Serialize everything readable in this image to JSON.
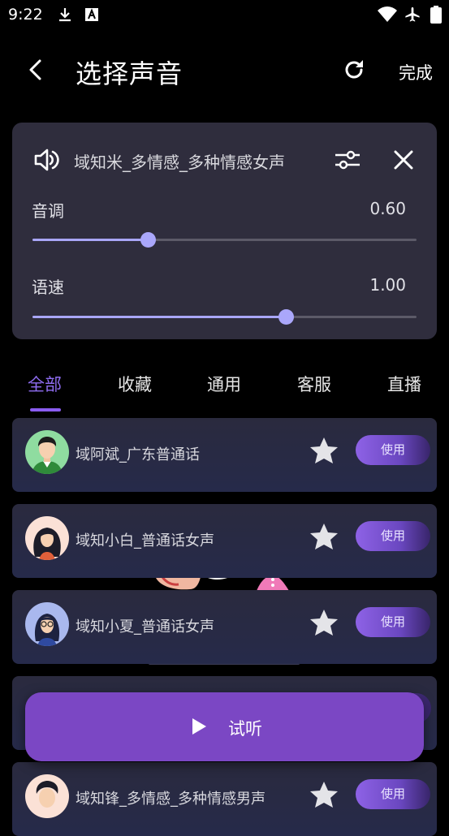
{
  "status_bar": {
    "time": "9:22"
  },
  "header": {
    "title": "选择声音",
    "done_label": "完成"
  },
  "current_voice": {
    "name": "域知米_多情感_多种情感女声",
    "pitch": {
      "label": "音调",
      "value": "0.60",
      "level": 0.3
    },
    "speed": {
      "label": "语速",
      "value": "1.00",
      "level": 0.66
    }
  },
  "tabs": [
    {
      "label": "全部",
      "active": true
    },
    {
      "label": "收藏",
      "active": false
    },
    {
      "label": "通用",
      "active": false
    },
    {
      "label": "客服",
      "active": false
    },
    {
      "label": "直播",
      "active": false
    }
  ],
  "voices": [
    {
      "name": "域阿斌_广东普通话",
      "action": "使用"
    },
    {
      "name": "域知小白_普通话女声",
      "action": "使用"
    },
    {
      "name": "域知小夏_普通话女声",
      "action": "使用"
    },
    {
      "name": "",
      "action": ""
    },
    {
      "name": "域知锋_多情感_多种情感男声",
      "action": "使用"
    }
  ],
  "listen_label": "试听",
  "colors": {
    "accent": "#8e6cf0",
    "listen_button": "#7b47c4",
    "panel": "#2f2d3d"
  }
}
